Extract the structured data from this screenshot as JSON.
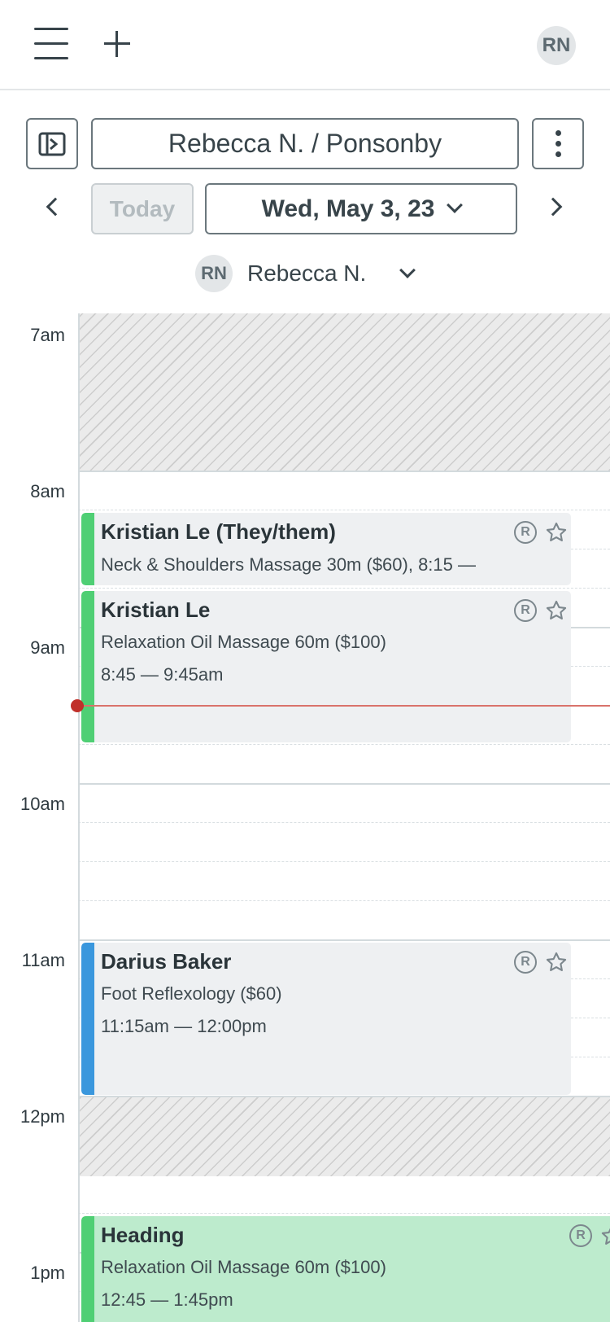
{
  "header": {
    "user_initials": "RN"
  },
  "toolbar": {
    "location": "Rebecca N. / Ponsonby",
    "today_label": "Today",
    "date": "Wed, May 3, 23",
    "staff_initials": "RN",
    "staff_name": "Rebecca N."
  },
  "calendar": {
    "hours": [
      "7am",
      "8am",
      "9am",
      "10am",
      "11am",
      "12pm",
      "1pm"
    ],
    "appointments": [
      {
        "client": "Kristian Le (They/them)",
        "service": "Neck & Shoulders Massage 30m ($60), 8:15 —",
        "time": "",
        "accent": "#4fcf74",
        "background": "#eef0f2"
      },
      {
        "client": "Kristian Le",
        "service": "Relaxation Oil Massage 60m ($100)",
        "time": "8:45 — 9:45am",
        "accent": "#4fcf74",
        "background": "#eef0f2"
      },
      {
        "client": "Darius Baker",
        "service": "Foot Reflexology ($60)",
        "time": "11:15am — 12:00pm",
        "accent": "#3a97dd",
        "background": "#eef0f2"
      },
      {
        "client": "Heading",
        "service": "Relaxation Oil Massage 60m ($100)",
        "time": "12:45 — 1:45pm",
        "accent": "#4fcf74",
        "background": "#bdebcd"
      }
    ],
    "badge_letter": "R",
    "colors": {
      "now_line": "#d9736b",
      "now_dot": "#c0302a"
    }
  }
}
